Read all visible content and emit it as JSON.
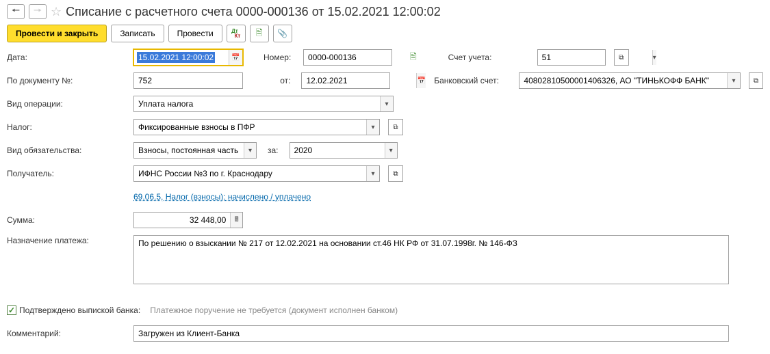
{
  "header": {
    "title": "Списание с расчетного счета 0000-000136 от 15.02.2021 12:00:02"
  },
  "toolbar": {
    "submit_close": "Провести и закрыть",
    "save": "Записать",
    "submit": "Провести"
  },
  "labels": {
    "date": "Дата:",
    "number": "Номер:",
    "account": "Счет учета:",
    "doc_number": "По документу №:",
    "doc_from": "от:",
    "bank_account": "Банковский счет:",
    "op_type": "Вид операции:",
    "tax": "Налог:",
    "obligation": "Вид обязательства:",
    "for": "за:",
    "recipient": "Получатель:",
    "amount": "Сумма:",
    "purpose": "Назначение платежа:",
    "confirmed": "Подтверждено выпиской банка:",
    "confirmed_hint": "Платежное поручение не требуется (документ исполнен банком)",
    "comment": "Комментарий:"
  },
  "values": {
    "date": "15.02.2021 12:00:02",
    "number": "0000-000136",
    "account": "51",
    "doc_number": "752",
    "doc_date": "12.02.2021",
    "bank_account": "40802810500001406326, АО \"ТИНЬКОФФ БАНК\"",
    "op_type": "Уплата налога",
    "tax": "Фиксированные взносы в ПФР",
    "obligation": "Взносы, постоянная часть",
    "period": "2020",
    "recipient": "ИФНС России №3 по г. Краснодару",
    "kbk_link": "69.06.5, Налог (взносы): начислено / уплачено",
    "amount": "32 448,00",
    "purpose": "По решению о взыскании № 217 от 12.02.2021 на основании ст.46 НК РФ от 31.07.1998г. № 146-ФЗ",
    "comment": "Загружен из Клиент-Банка"
  }
}
